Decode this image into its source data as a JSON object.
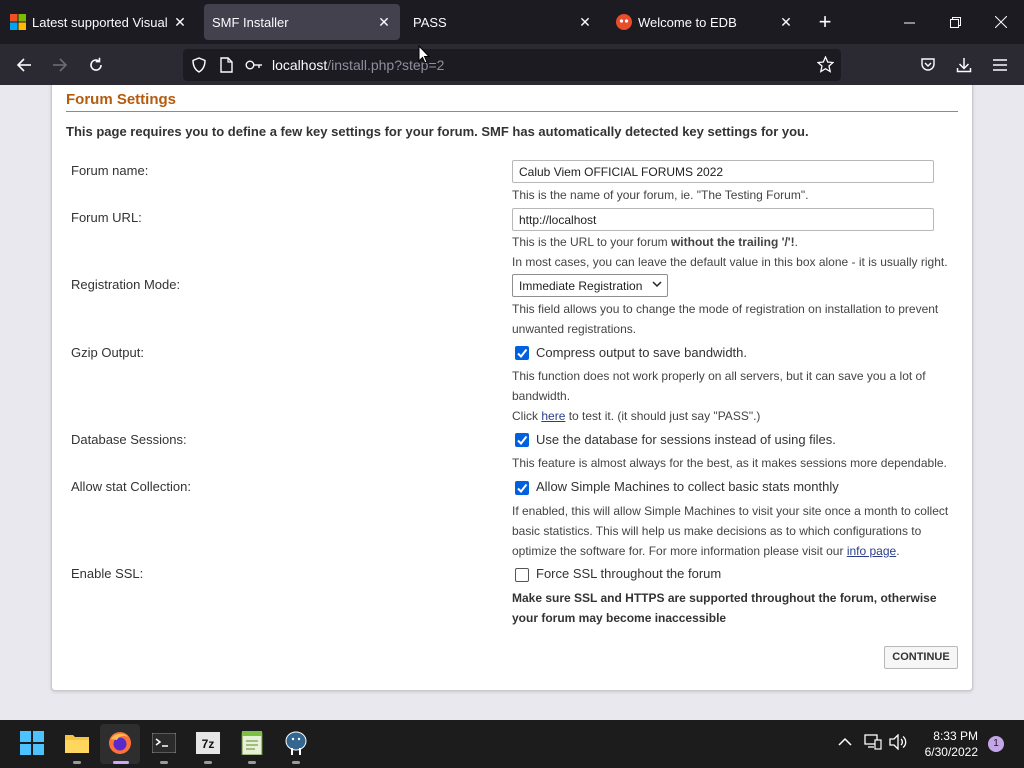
{
  "browser": {
    "tabs": [
      {
        "title": "Latest supported Visual C++",
        "active": false,
        "icon": "microsoft-icon"
      },
      {
        "title": "SMF Installer",
        "active": true,
        "icon": ""
      },
      {
        "title": "PASS",
        "active": false,
        "icon": ""
      },
      {
        "title": "Welcome to EDB",
        "active": false,
        "icon": "edb-icon"
      }
    ],
    "url_host": "localhost",
    "url_path": "/install.php?step=2"
  },
  "page": {
    "section_title": "Forum Settings",
    "intro": "This page requires you to define a few key settings for your forum. SMF has automatically detected key settings for you.",
    "forum_name": {
      "label": "Forum name:",
      "value": "Calub Viem OFFICIAL FORUMS 2022",
      "help": "This is the name of your forum, ie. \"The Testing Forum\"."
    },
    "forum_url": {
      "label": "Forum URL:",
      "value": "http://localhost",
      "help_prefix": "This is the URL to your forum ",
      "help_bold": "without the trailing '/'!",
      "help_suffix": ".",
      "help2": "In most cases, you can leave the default value in this box alone - it is usually right."
    },
    "registration": {
      "label": "Registration Mode:",
      "selected": "Immediate Registration",
      "help_line1": "This field allows you to change the mode of registration on installation to prevent",
      "help_line2": "unwanted registrations."
    },
    "gzip": {
      "label": "Gzip Output:",
      "checkbox_label": "Compress output to save bandwidth.",
      "checked": true,
      "help_line1": "This function does not work properly on all servers, but it can save you a lot of",
      "help_line2": "bandwidth.",
      "click_prefix": "Click ",
      "click_link": "here",
      "click_suffix": " to test it. (it should just say \"PASS\".)"
    },
    "db_sessions": {
      "label": "Database Sessions:",
      "checkbox_label": "Use the database for sessions instead of using files.",
      "checked": true,
      "help": "This feature is almost always for the best, as it makes sessions more dependable."
    },
    "stats": {
      "label": "Allow stat Collection:",
      "checkbox_label": "Allow Simple Machines to collect basic stats monthly",
      "checked": true,
      "help_line1": "If enabled, this will allow Simple Machines to visit your site once a month to collect",
      "help_line2": "basic statistics. This will help us make decisions as to which configurations to",
      "help_line3_prefix": "optimize the software for. For more information please visit our ",
      "help_link": "info page",
      "help_line3_suffix": "."
    },
    "ssl": {
      "label": "Enable SSL:",
      "checkbox_label": "Force SSL throughout the forum",
      "checked": false,
      "warn_line1": "Make sure SSL and HTTPS are supported throughout the forum, otherwise",
      "warn_line2": "your forum may become inaccessible"
    },
    "continue_label": "CONTINUE"
  },
  "taskbar": {
    "time": "8:33 PM",
    "date": "6/30/2022",
    "notification_count": "1"
  }
}
